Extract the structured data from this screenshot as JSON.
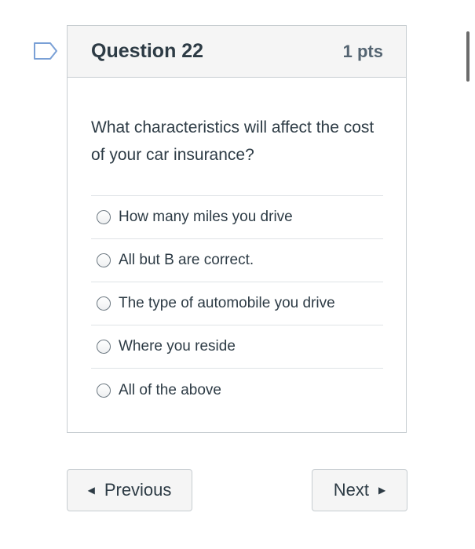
{
  "question": {
    "title": "Question 22",
    "points": "1 pts",
    "text": "What characteristics will affect the cost of your car insurance?",
    "answers": [
      {
        "label": "How many miles you drive"
      },
      {
        "label": "All but B are correct."
      },
      {
        "label": "The type of automobile you drive"
      },
      {
        "label": "Where you reside"
      },
      {
        "label": "All of the above"
      }
    ]
  },
  "navigation": {
    "previous_label": "Previous",
    "next_label": "Next"
  },
  "icons": {
    "flag": "flag-icon",
    "previous_caret": "caret-left-icon",
    "next_caret": "caret-right-icon"
  },
  "colors": {
    "flag_outline": "#7aa0d6",
    "text": "#2d3b45",
    "header_background": "#f5f5f5",
    "border": "#c7cdd1"
  }
}
